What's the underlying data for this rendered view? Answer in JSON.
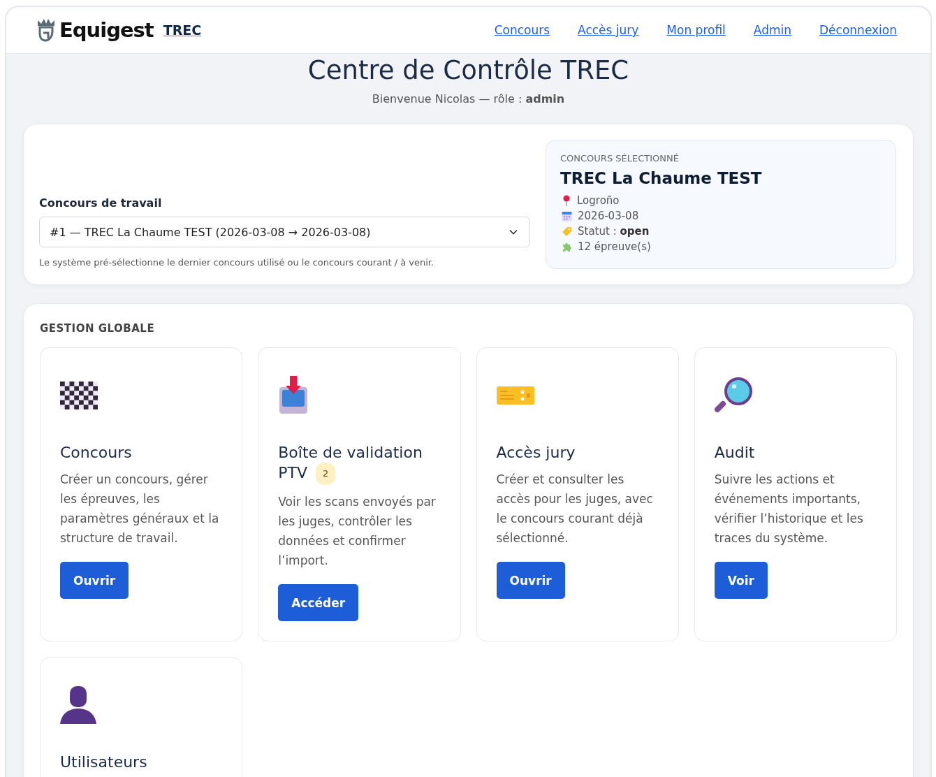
{
  "brand": {
    "name": "Equigest",
    "link": "TREC"
  },
  "nav": [
    "Concours",
    "Accès jury",
    "Mon profil",
    "Admin",
    "Déconnexion"
  ],
  "page": {
    "title": "Centre de Contrôle TREC",
    "welcome": "Bienvenue Nicolas — rôle : **admin**"
  },
  "working_contest": {
    "label": "Concours de travail",
    "value": "#1 — TREC La Chaume TEST (2026-03-08 → 2026-03-08)",
    "hint": "Le système pré-sélectionne le dernier concours utilisé ou le concours courant / à venir."
  },
  "selected_contest": {
    "eyebrow": "CONCOURS SÉLECTIONNÉ",
    "name": "TREC La Chaume TEST",
    "details": [
      {
        "kind": "place",
        "text": "Logroño"
      },
      {
        "kind": "date",
        "text": "2026-03-08"
      },
      {
        "kind": "status",
        "text": "Statut : **open**"
      },
      {
        "kind": "events",
        "text": "12 épreuve(s)"
      }
    ]
  },
  "section": {
    "title": "GESTION GLOBALE",
    "cards": [
      {
        "kind": "flag",
        "title": "Concours",
        "description": "Créer un concours, gérer les épreuves, les paramètres généraux et la structure de travail.",
        "button": "Ouvrir"
      },
      {
        "kind": "inbox",
        "title": "Boîte de validation PTV",
        "badge": "2",
        "description": "Voir les scans envoyés par les juges, contrôler les données et confirmer l’import.",
        "button": "Accéder"
      },
      {
        "kind": "ticket",
        "title": "Accès jury",
        "description": "Créer et consulter les accès pour les juges, avec le concours courant déjà sélectionné.",
        "button": "Ouvrir"
      },
      {
        "kind": "search",
        "title": "Audit",
        "description": "Suivre les actions et événements importants, vérifier l’historique et les traces du système.",
        "button": "Voir"
      },
      {
        "kind": "user",
        "title": "Utilisateurs"
      }
    ]
  }
}
